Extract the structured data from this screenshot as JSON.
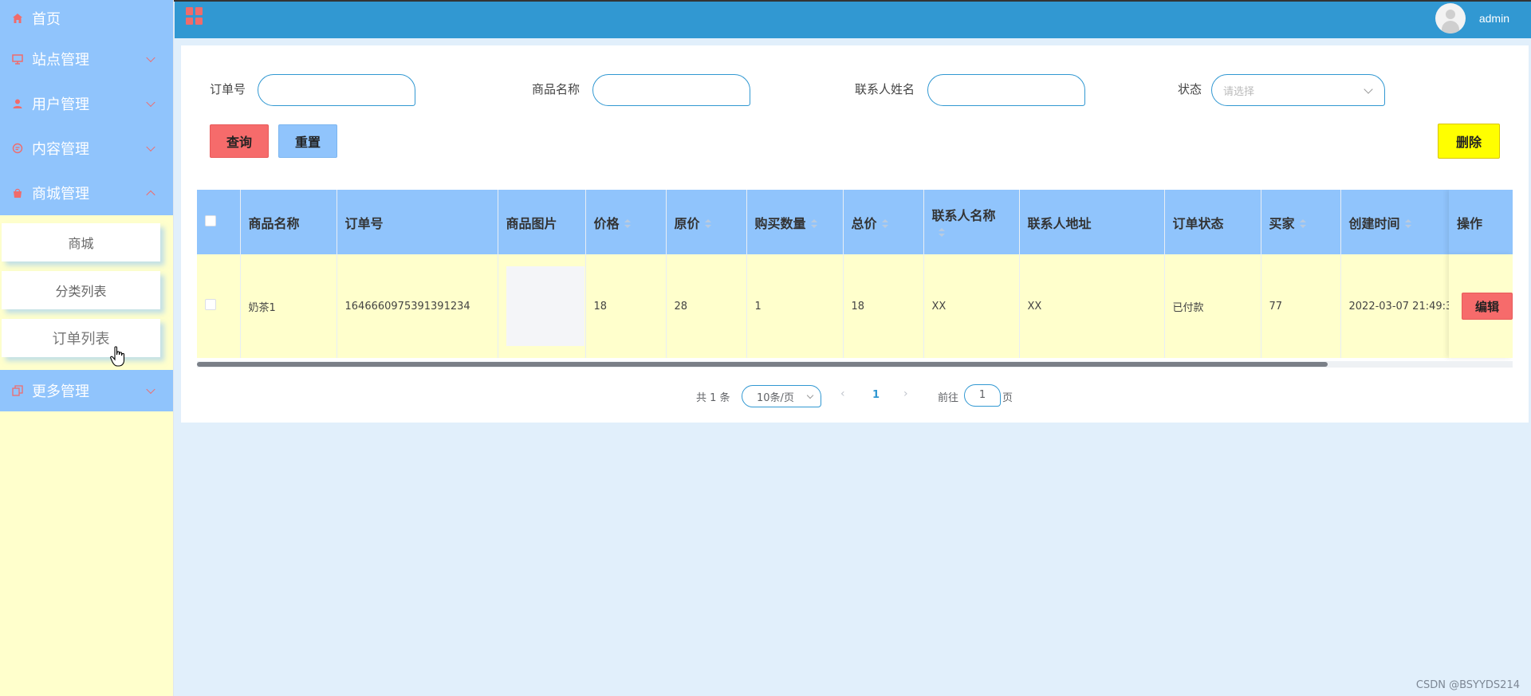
{
  "sidebar": {
    "home": "首页",
    "menus": [
      "站点管理",
      "用户管理",
      "内容管理",
      "商城管理"
    ],
    "sub_items": [
      "商城",
      "分类列表",
      "订单列表"
    ],
    "more": "更多管理"
  },
  "header": {
    "username": "admin"
  },
  "filters": {
    "order_no_label": "订单号",
    "product_name_label": "商品名称",
    "contact_name_label": "联系人姓名",
    "status_label": "状态",
    "status_placeholder": "请选择"
  },
  "buttons": {
    "query": "查询",
    "reset": "重置",
    "delete": "删除",
    "edit": "编辑"
  },
  "table": {
    "columns": [
      "商品名称",
      "订单号",
      "商品图片",
      "价格",
      "原价",
      "购买数量",
      "总价",
      "联系人名称",
      "联系人地址",
      "订单状态",
      "买家",
      "创建时间",
      "操作"
    ],
    "rows": [
      {
        "product_name": "奶茶1",
        "order_no": "1646660975391391234",
        "price": "18",
        "original_price": "28",
        "quantity": "1",
        "total": "18",
        "contact_name": "XX",
        "contact_address": "XX",
        "order_status": "已付款",
        "buyer": "77",
        "created_at": "2022-03-07 21:49:3"
      }
    ]
  },
  "pagination": {
    "total_text": "共 1 条",
    "page_size": "10条/页",
    "current_page": "1",
    "goto_label": "前往",
    "goto_value": "1",
    "page_suffix": "页"
  },
  "watermark": "CSDN @BSYYDS214",
  "colors": {
    "header": "#3198d2",
    "menu": "#90c4fc",
    "accent": "#f66b6b",
    "sidebar_bg": "#ffffcc",
    "delete": "#ffff00"
  }
}
